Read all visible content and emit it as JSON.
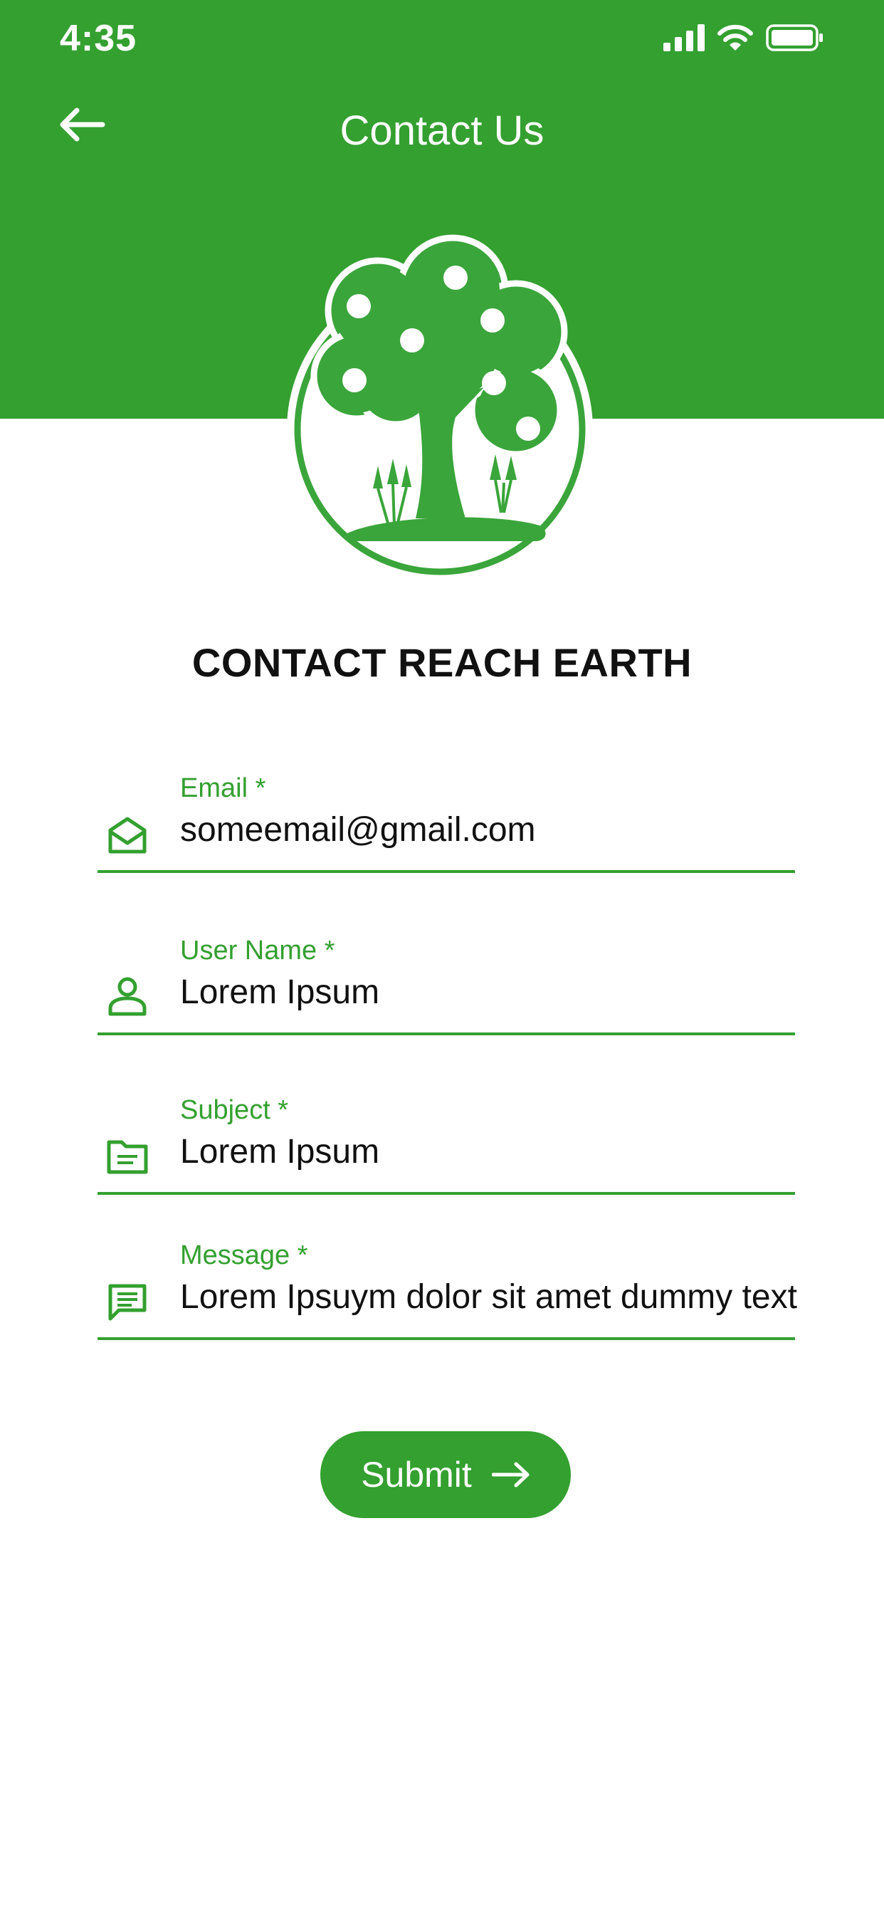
{
  "status_bar": {
    "time": "4:35"
  },
  "nav": {
    "title": "Contact Us"
  },
  "page": {
    "title": "CONTACT REACH EARTH"
  },
  "form": {
    "email": {
      "label": "Email *",
      "value": "someemail@gmail.com"
    },
    "username": {
      "label": "User Name *",
      "value": "Lorem Ipsum"
    },
    "subject": {
      "label": "Subject *",
      "value": "Lorem Ipsum"
    },
    "message": {
      "label": "Message *",
      "value": "Lorem Ipsuym dolor sit amet dummy text"
    }
  },
  "submit": {
    "label": "Submit"
  },
  "icons": {
    "back": "arrow-left-icon",
    "email": "envelope-open-icon",
    "username": "person-icon",
    "subject": "folder-icon",
    "message": "message-icon",
    "submit": "arrow-right-icon"
  },
  "colors": {
    "brand_green": "#33a02f",
    "text": "#111111",
    "background": "#ffffff"
  }
}
